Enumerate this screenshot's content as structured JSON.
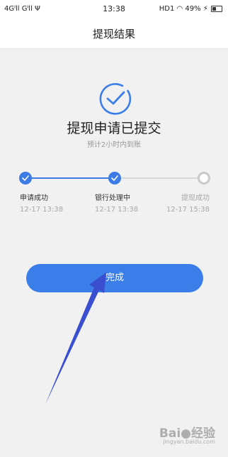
{
  "status_bar": {
    "left": "4Gᴵll Gᴵll Ψ",
    "time": "13:38",
    "right": "HD1 ◠ 49% ⚡"
  },
  "nav": {
    "title": "提现结果"
  },
  "result": {
    "title": "提现申请已提交",
    "subtitle": "预计2小时内到账"
  },
  "steps": [
    {
      "label": "申请成功",
      "time": "12-17 13:38",
      "status": "done"
    },
    {
      "label": "银行处理中",
      "time": "12-17 13:38",
      "status": "done"
    },
    {
      "label": "提现成功",
      "time": "12-17 15:38",
      "status": "pending"
    }
  ],
  "done_button": {
    "label": "完成"
  },
  "watermark": {
    "text": "Bai●经验",
    "sub": "jingyan.baidu.com"
  },
  "colors": {
    "accent": "#3b7de9",
    "pending": "#c9c9c9",
    "muted": "#a8a8a8",
    "arrow": "#3a4fcf"
  },
  "icons": {
    "result": "check-circle-icon",
    "annotation": "pointer-arrow-icon"
  }
}
